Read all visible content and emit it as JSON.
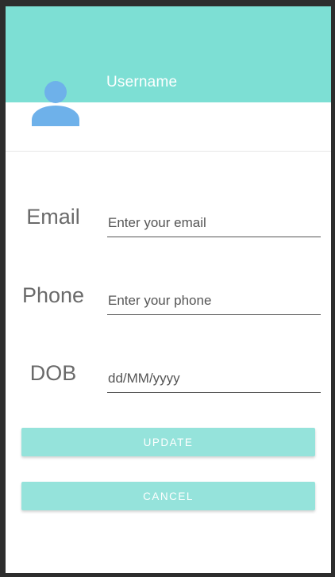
{
  "header": {
    "username": "Username",
    "avatar_icon": "person-icon",
    "colors": {
      "header_bg": "#7ddfd4",
      "avatar": "#6eb1ea"
    }
  },
  "form": {
    "email": {
      "label": "Email",
      "placeholder": "Enter your email",
      "value": ""
    },
    "phone": {
      "label": "Phone",
      "placeholder": "Enter your phone",
      "value": ""
    },
    "dob": {
      "label": "DOB",
      "placeholder": "dd/MM/yyyy",
      "value": ""
    }
  },
  "actions": {
    "update_label": "UPDATE",
    "cancel_label": "CANCEL",
    "button_color": "#95e3db"
  }
}
